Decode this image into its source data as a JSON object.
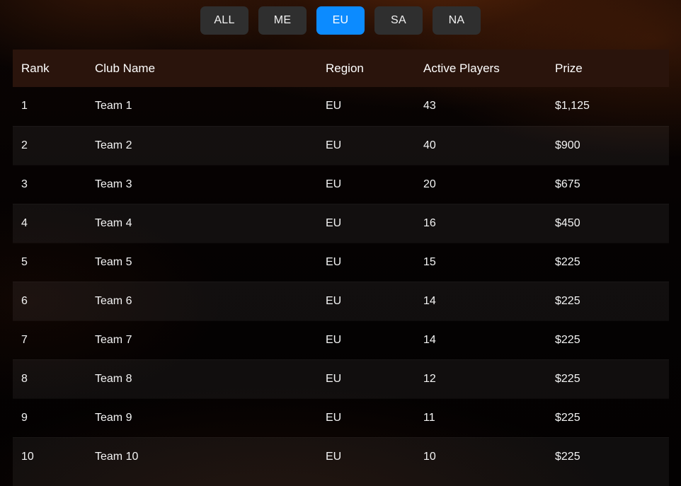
{
  "filters": {
    "name": "region-filter",
    "buttons": [
      {
        "label": "ALL",
        "active": false
      },
      {
        "label": "ME",
        "active": false
      },
      {
        "label": "EU",
        "active": true
      },
      {
        "label": "SA",
        "active": false
      },
      {
        "label": "NA",
        "active": false
      }
    ],
    "active_value": "EU",
    "active_color": "#0c8bff",
    "inactive_color": "#2f2f2f"
  },
  "leaderboard": {
    "header_bg": "#2a140c",
    "columns": [
      "Rank",
      "Club Name",
      "Region",
      "Active Players",
      "Prize"
    ],
    "rows": [
      {
        "rank": "1",
        "club": "Team 1",
        "region": "EU",
        "players": "43",
        "prize": "$1,125"
      },
      {
        "rank": "2",
        "club": "Team 2",
        "region": "EU",
        "players": "40",
        "prize": "$900"
      },
      {
        "rank": "3",
        "club": "Team 3",
        "region": "EU",
        "players": "20",
        "prize": "$675"
      },
      {
        "rank": "4",
        "club": "Team 4",
        "region": "EU",
        "players": "16",
        "prize": "$450"
      },
      {
        "rank": "5",
        "club": "Team 5",
        "region": "EU",
        "players": "15",
        "prize": "$225"
      },
      {
        "rank": "6",
        "club": "Team 6",
        "region": "EU",
        "players": "14",
        "prize": "$225"
      },
      {
        "rank": "7",
        "club": "Team 7",
        "region": "EU",
        "players": "14",
        "prize": "$225"
      },
      {
        "rank": "8",
        "club": "Team 8",
        "region": "EU",
        "players": "12",
        "prize": "$225"
      },
      {
        "rank": "9",
        "club": "Team 9",
        "region": "EU",
        "players": "11",
        "prize": "$225"
      },
      {
        "rank": "10",
        "club": "Team 10",
        "region": "EU",
        "players": "10",
        "prize": "$225"
      }
    ]
  }
}
